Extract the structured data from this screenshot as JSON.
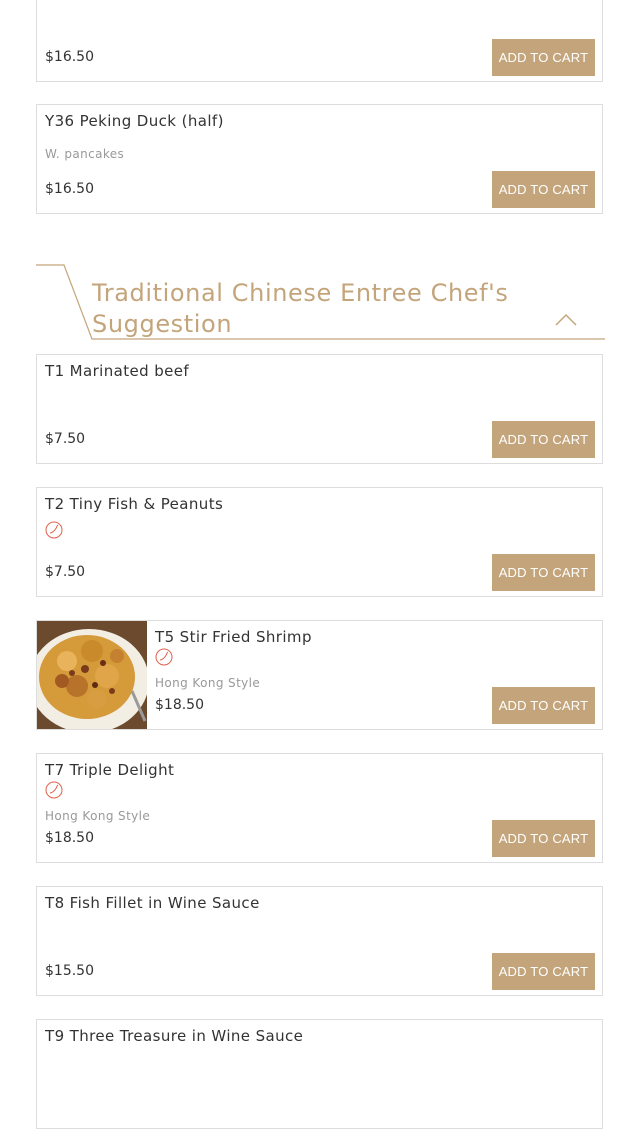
{
  "accent_color": "#c4a57b",
  "items_top": [
    {
      "price": "$16.50",
      "button": "ADD TO CART"
    },
    {
      "name": "Y36 Peking Duck (half)",
      "desc": "W. pancakes",
      "price": "$16.50",
      "button": "ADD TO CART"
    }
  ],
  "section": {
    "title": "Traditional Chinese Entree Chef's Suggestion",
    "toggle_icon": "chevron-up-icon"
  },
  "items": [
    {
      "name": "T1 Marinated beef",
      "price": "$7.50",
      "button": "ADD TO CART"
    },
    {
      "name": "T2 Tiny Fish & Peanuts",
      "spicy": true,
      "price": "$7.50",
      "button": "ADD TO CART"
    },
    {
      "name": "T5 Stir Fried Shrimp",
      "spicy": true,
      "desc": "Hong Kong Style",
      "price": "$18.50",
      "button": "ADD TO CART",
      "image": "stir-fried-shrimp-photo"
    },
    {
      "name": "T7 Triple Delight",
      "spicy": true,
      "desc": "Hong Kong Style",
      "price": "$18.50",
      "button": "ADD TO CART"
    },
    {
      "name": "T8 Fish Fillet in Wine Sauce",
      "price": "$15.50",
      "button": "ADD TO CART"
    },
    {
      "name": "T9 Three Treasure in Wine Sauce"
    }
  ]
}
